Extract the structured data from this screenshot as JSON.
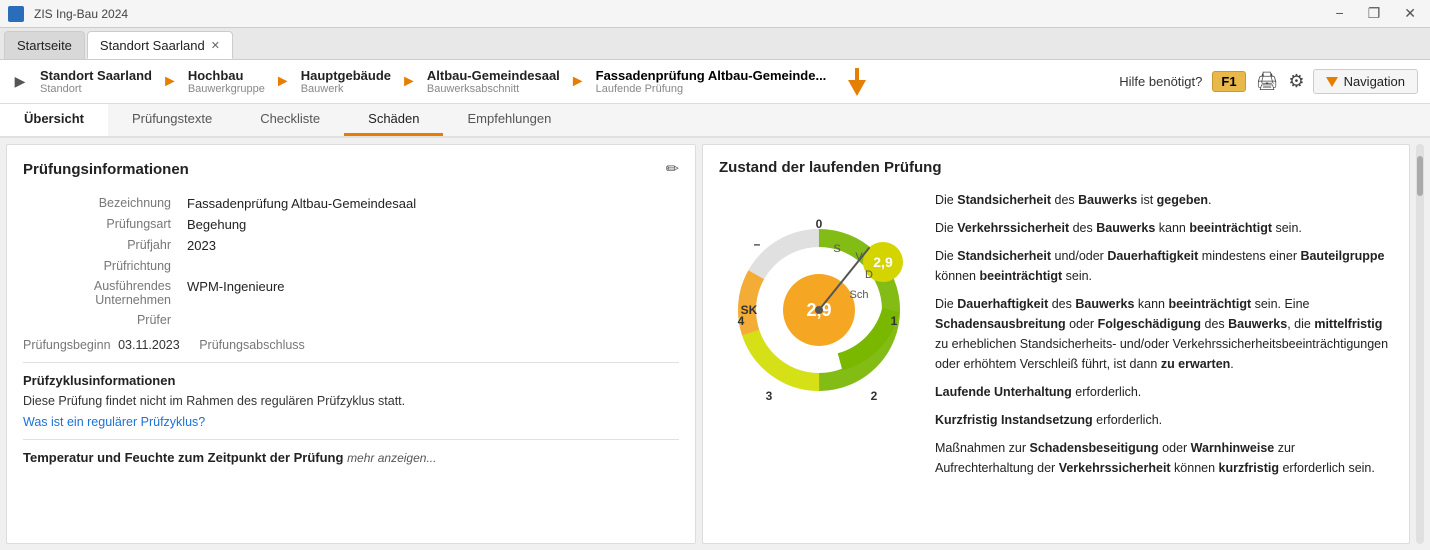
{
  "titlebar": {
    "title": "ZIS Ing-Bau 2024",
    "min": "−",
    "restore": "❐",
    "close": "✕"
  },
  "tabs": [
    {
      "id": "startseite",
      "label": "Startseite",
      "closable": false,
      "active": false
    },
    {
      "id": "standort-saarland",
      "label": "Standort Saarland",
      "closable": true,
      "active": true
    }
  ],
  "breadcrumb": {
    "items": [
      {
        "name": "Standort Saarland",
        "type": "Standort"
      },
      {
        "name": "Hochbau",
        "type": "Bauwerkgruppe"
      },
      {
        "name": "Hauptgebäude",
        "type": "Bauwerk"
      },
      {
        "name": "Altbau-Gemeindesaal",
        "type": "Bauwerksabschnitt"
      },
      {
        "name": "Fassadenprüfung Altbau-Gemeinde...",
        "type": "Laufende Prüfung"
      }
    ],
    "navigation_label": "Navigation"
  },
  "section_tabs": [
    {
      "id": "uebersicht",
      "label": "Übersicht",
      "active": true
    },
    {
      "id": "pruefungstexte",
      "label": "Prüfungstexte",
      "active": false
    },
    {
      "id": "checkliste",
      "label": "Checkliste",
      "active": false
    },
    {
      "id": "schaeden",
      "label": "Schäden",
      "active": false
    },
    {
      "id": "empfehlungen",
      "label": "Empfehlungen",
      "active": false
    }
  ],
  "left_panel": {
    "title": "Prüfungsinformationen",
    "fields": [
      {
        "label": "Bezeichnung",
        "value": "Fassadenprüfung Altbau-Gemeindesaal"
      },
      {
        "label": "Prüfungsart",
        "value": "Begehung"
      },
      {
        "label": "Prüfjahr",
        "value": "2023"
      },
      {
        "label": "Prüfrichtung",
        "value": ""
      },
      {
        "label": "Ausführendes Unternehmen",
        "value": "WPM-Ingenieure"
      },
      {
        "label": "Prüfer",
        "value": ""
      }
    ],
    "pruefungsbeginn_label": "Prüfungsbeginn",
    "pruefungsbeginn_value": "03.11.2023",
    "pruefungsabschluss_label": "Prüfungsabschluss",
    "pruefungsabschluss_value": "",
    "zyklus_title": "Prüfzyklusinformationen",
    "zyklus_text": "Diese Prüfung findet nicht im Rahmen des regulären Prüfzyklus statt.",
    "zyklus_link": "Was ist ein regulärer Prüfzyklus?",
    "temp_label": "Temperatur und Feuchte zum Zeitpunkt der Prüfung",
    "temp_expand": "mehr anzeigen..."
  },
  "right_panel": {
    "title": "Zustand der laufenden Prüfung",
    "gauge": {
      "sk_label": "SK",
      "center_value": "2,9",
      "outer_value": "2,9",
      "axis_labels": [
        "S",
        "V",
        "D",
        "Sch"
      ],
      "tick_labels": [
        "0",
        "1",
        "2",
        "3",
        "4",
        "-"
      ]
    },
    "descriptions": [
      {
        "text_parts": [
          {
            "text": "Die ",
            "bold": false
          },
          {
            "text": "Standsicherheit",
            "bold": true
          },
          {
            "text": " des ",
            "bold": false
          },
          {
            "text": "Bauwerks",
            "bold": true
          },
          {
            "text": " ist ",
            "bold": false
          },
          {
            "text": "gegeben",
            "bold": true
          },
          {
            "text": ".",
            "bold": false
          }
        ]
      },
      {
        "text_parts": [
          {
            "text": "Die ",
            "bold": false
          },
          {
            "text": "Verkehrssicherheit",
            "bold": true
          },
          {
            "text": " des ",
            "bold": false
          },
          {
            "text": "Bauwerks",
            "bold": true
          },
          {
            "text": " kann ",
            "bold": false
          },
          {
            "text": "beeinträchtigt",
            "bold": true
          },
          {
            "text": " sein.",
            "bold": false
          }
        ]
      },
      {
        "text_parts": [
          {
            "text": "Die ",
            "bold": false
          },
          {
            "text": "Standsicherheit",
            "bold": true
          },
          {
            "text": " und/oder ",
            "bold": false
          },
          {
            "text": "Dauerhaftigkeit",
            "bold": true
          },
          {
            "text": " mindestens einer ",
            "bold": false
          },
          {
            "text": "Bauteilgruppe",
            "bold": true
          },
          {
            "text": " können ",
            "bold": false
          },
          {
            "text": "beeinträchtigt",
            "bold": true
          },
          {
            "text": " sein.",
            "bold": false
          }
        ]
      },
      {
        "text_parts": [
          {
            "text": "Die ",
            "bold": false
          },
          {
            "text": "Dauerhaftigkeit",
            "bold": true
          },
          {
            "text": " des ",
            "bold": false
          },
          {
            "text": "Bauwerks",
            "bold": true
          },
          {
            "text": " kann ",
            "bold": false
          },
          {
            "text": "beeinträchtigt",
            "bold": true
          },
          {
            "text": " sein. Eine ",
            "bold": false
          },
          {
            "text": "Schadensausbreitung",
            "bold": true
          },
          {
            "text": " oder ",
            "bold": false
          },
          {
            "text": "Folgeschädigung",
            "bold": true
          },
          {
            "text": " des ",
            "bold": false
          },
          {
            "text": "Bauwerks",
            "bold": true
          },
          {
            "text": ", die ",
            "bold": false
          },
          {
            "text": "mittelfristig",
            "bold": true
          },
          {
            "text": " zu erheblichen Standsicherheits- und/oder Verkehrssicherheitsbeeinträchtigungen oder erhöhtem Verschleiß führt, ist dann ",
            "bold": false
          },
          {
            "text": "zu erwarten",
            "bold": true
          },
          {
            "text": ".",
            "bold": false
          }
        ]
      },
      {
        "text_parts": [
          {
            "text": "Laufende Unterhaltung",
            "bold": true
          },
          {
            "text": " erforderlich.",
            "bold": false
          }
        ]
      },
      {
        "text_parts": [
          {
            "text": "Kurzfristig Instandsetzung",
            "bold": true
          },
          {
            "text": " erforderlich.",
            "bold": false
          }
        ]
      },
      {
        "text_parts": [
          {
            "text": "Maßnahmen zur ",
            "bold": false
          },
          {
            "text": "Schadensbeseitigung",
            "bold": true
          },
          {
            "text": " oder ",
            "bold": false
          },
          {
            "text": "Warnhinweise",
            "bold": true
          },
          {
            "text": " zur Aufrechterhaltung der ",
            "bold": false
          },
          {
            "text": "Verkehrssicherheit",
            "bold": true
          },
          {
            "text": " können ",
            "bold": false
          },
          {
            "text": "kurzfristig",
            "bold": true
          },
          {
            "text": " erforderlich sein.",
            "bold": false
          }
        ]
      }
    ]
  },
  "hilfe": {
    "label": "Hilfe benötigt?",
    "f1": "F1"
  },
  "colors": {
    "orange": "#e67e00",
    "yellow_green": "#c8d400",
    "green": "#7ab800",
    "link_blue": "#1a73d6",
    "gauge_orange": "#f5a623",
    "gauge_yellow": "#d4e000"
  }
}
